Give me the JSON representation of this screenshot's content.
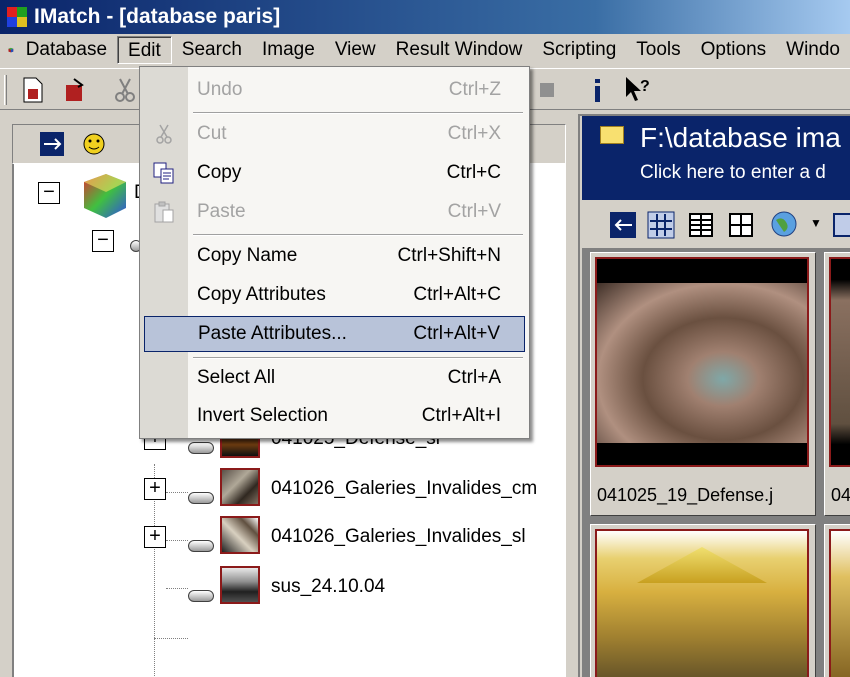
{
  "window": {
    "title": "IMatch - [database paris]"
  },
  "menubar": {
    "items": [
      "Database",
      "Edit",
      "Search",
      "Image",
      "View",
      "Result Window",
      "Scripting",
      "Tools",
      "Options",
      "Windo"
    ]
  },
  "edit_menu": {
    "items": [
      {
        "label": "Undo",
        "shortcut": "Ctrl+Z",
        "disabled": true
      },
      {
        "label": "Cut",
        "shortcut": "Ctrl+X",
        "disabled": true
      },
      {
        "label": "Copy",
        "shortcut": "Ctrl+C",
        "disabled": false
      },
      {
        "label": "Paste",
        "shortcut": "Ctrl+V",
        "disabled": true
      },
      {
        "label": "Copy Name",
        "shortcut": "Ctrl+Shift+N",
        "disabled": false
      },
      {
        "label": "Copy Attributes",
        "shortcut": "Ctrl+Alt+C",
        "disabled": false
      },
      {
        "label": "Paste Attributes...",
        "shortcut": "Ctrl+Alt+V",
        "disabled": false,
        "selected": true
      },
      {
        "label": "Select All",
        "shortcut": "Ctrl+A",
        "disabled": false
      },
      {
        "label": "Invert Selection",
        "shortcut": "Ctrl+Alt+I",
        "disabled": false
      }
    ]
  },
  "tree": {
    "root_label": "D",
    "items": [
      {
        "label": "041025_Defense_sl"
      },
      {
        "label": "041026_Galeries_Invalides_cm"
      },
      {
        "label": "041026_Galeries_Invalides_sl"
      },
      {
        "label": "sus_24.10.04"
      }
    ]
  },
  "result_window": {
    "path": "F:\\database ima",
    "hint": "Click here to enter a d",
    "thumbnails": [
      {
        "caption": "041025_19_Defense.j"
      },
      {
        "caption": "04"
      }
    ]
  },
  "colors": {
    "title_bar": "#0a246a",
    "thumb_border": "#8b1a1a",
    "selection": "#b8c3d9"
  }
}
